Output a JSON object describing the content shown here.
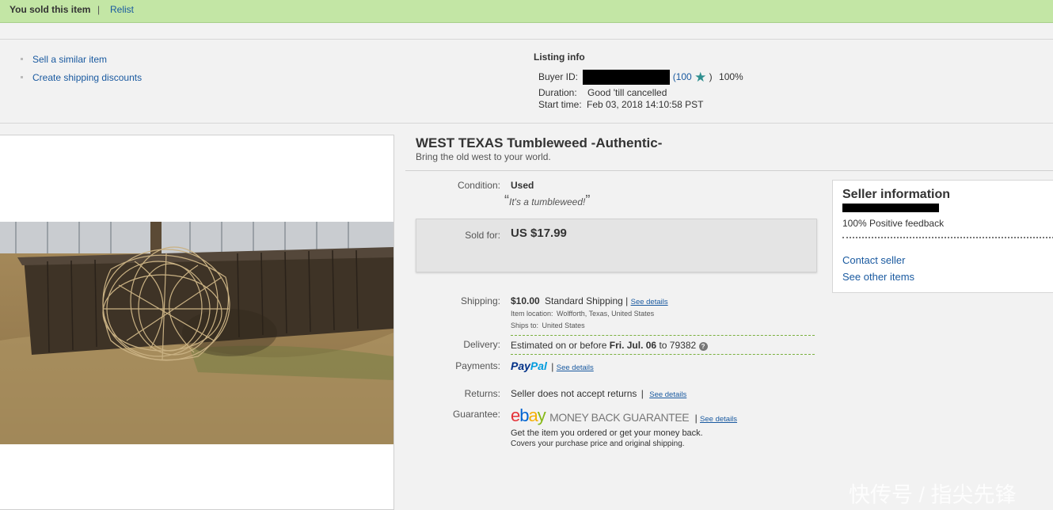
{
  "banner": {
    "sold_text": "You sold this item",
    "separator": "|",
    "relist": "Relist"
  },
  "actions": [
    "Sell a similar item",
    "Create shipping discounts"
  ],
  "listing_info": {
    "header": "Listing info",
    "buyer_label": "Buyer ID:",
    "feedback_open": "(100",
    "feedback_close": ")",
    "feedback_pct": "100%",
    "duration_label": "Duration:",
    "duration_value": "Good 'till cancelled",
    "start_label": "Start time:",
    "start_value": "Feb 03, 2018 14:10:58 PST"
  },
  "item": {
    "title": "WEST TEXAS Tumbleweed -Authentic-",
    "subtitle": "Bring the old west to your world.",
    "condition_label": "Condition:",
    "condition_value": "Used",
    "condition_note": "It's a tumbleweed!",
    "quote_open": "“",
    "quote_close": "”",
    "sold_label": "Sold for:",
    "sold_price": "US $17.99"
  },
  "shipping": {
    "label": "Shipping:",
    "cost": "$10.00",
    "method": "Standard Shipping",
    "bar": "|",
    "see_details": "See details",
    "location_label": "Item location:",
    "location": "Wolfforth, Texas, United States",
    "ships_to_label": "Ships to:",
    "ships_to": "United States"
  },
  "delivery": {
    "label": "Delivery:",
    "prefix": "Estimated on or before",
    "date": "Fri. Jul. 06",
    "suffix": "to 79382",
    "help": "?"
  },
  "payments": {
    "label": "Payments:",
    "pay": "Pay",
    "pal": "Pal",
    "bar": "|",
    "see_details": "See details"
  },
  "returns": {
    "label": "Returns:",
    "value": "Seller does not accept returns",
    "bar": "|",
    "see_details": "See details"
  },
  "guarantee": {
    "label": "Guarantee:",
    "logo_e": "e",
    "logo_b": "b",
    "logo_a": "a",
    "logo_y": "y",
    "title": "MONEY BACK GUARANTEE",
    "bar": "|",
    "see_details": "See details",
    "line1": "Get the item you ordered or get your money back.",
    "line2": "Covers your purchase price and original shipping."
  },
  "seller": {
    "header": "Seller information",
    "feedback": "100% Positive feedback",
    "contact": "Contact seller",
    "other_items": "See other items"
  },
  "watermark": "快传号 / 指尖先锋",
  "colors": {
    "banner_bg": "#c3e6a5",
    "link": "#1a5aa0",
    "ebay_e": "#e53238",
    "ebay_b": "#0064d2",
    "ebay_a": "#f5af02",
    "ebay_y": "#86b817",
    "paypal_dark": "#003087",
    "paypal_light": "#009cde"
  },
  "icons": [
    "star-icon",
    "help-icon"
  ]
}
